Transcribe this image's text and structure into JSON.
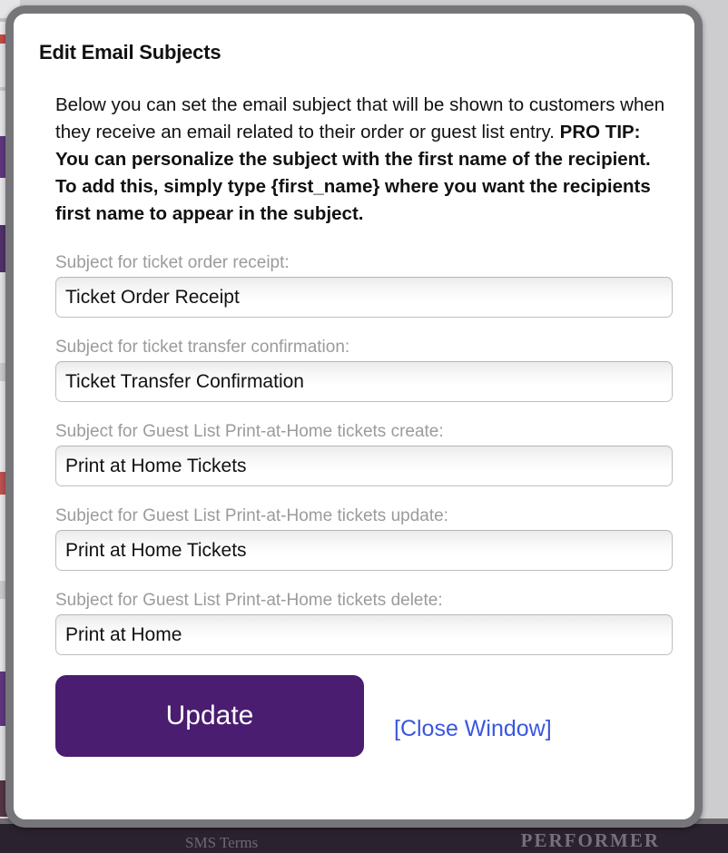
{
  "modal": {
    "title": "Edit Email Subjects",
    "intro_plain": "Below you can set the email subject that will be shown to customers when they receive an email related to their order or guest list entry. ",
    "intro_bold": "PRO TIP: You can personalize the subject with the first name of the recipient. To add this, simply type {first_name} where you want the recipients first name to appear in the subject.",
    "fields": [
      {
        "label": "Subject for ticket order receipt:",
        "value": "Ticket Order Receipt",
        "placeholder": ""
      },
      {
        "label": "Subject for ticket transfer confirmation:",
        "value": "Ticket Transfer Confirmation",
        "placeholder": ""
      },
      {
        "label": "Subject for Guest List Print-at-Home tickets create:",
        "value": "Print at Home Tickets",
        "placeholder": ""
      },
      {
        "label": "Subject for Guest List Print-at-Home tickets update:",
        "value": "Print at Home Tickets",
        "placeholder": ""
      },
      {
        "label": "Subject for Guest List Print-at-Home tickets delete:",
        "value": "Print at Home",
        "placeholder": ""
      }
    ],
    "update_label": "Update",
    "close_label": "[Close Window]"
  },
  "background": {
    "footer_left_text": "SMS Terms",
    "footer_right_text": "PERFORMER"
  },
  "colors": {
    "accent_purple": "#4a1d70",
    "link_blue": "#3a56e0",
    "label_gray": "#9b9b9b",
    "modal_border": "#76767a",
    "footer_dark": "#2b2230"
  }
}
